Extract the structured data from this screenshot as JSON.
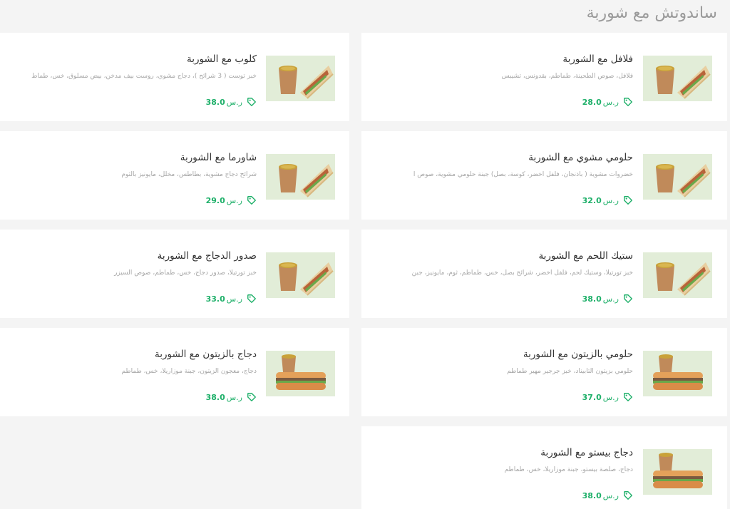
{
  "section": {
    "title": "ساندوتش مع شوربة"
  },
  "currency": "ر.س",
  "colors": {
    "accent": "#1fb06a",
    "thumb_bg": "#e2edd8"
  },
  "items": [
    {
      "name": "فلافل مع الشوربة",
      "description": "فلافل، صوص الطحينة، طماطم، بقدونس، تشيبس",
      "price": "28.0"
    },
    {
      "name": "كلوب مع الشوربة",
      "description": "خبز توست ( 3 شرائح )، دجاج مشوي، روست بيف مدخن، بيض مسلوق، خس، طماط",
      "price": "38.0"
    },
    {
      "name": "حلومي مشوي مع الشوربة",
      "description": "خضروات مشوية ( باذنجان، فلفل اخضر، كوسة، بصل) جبنة حلومي مشوية، صوص ا",
      "price": "32.0"
    },
    {
      "name": "شاورما مع الشوربة",
      "description": "شرائح دجاج مشوية، بطاطس، مخلل، مايونيز بالثوم",
      "price": "29.0"
    },
    {
      "name": "ستيك اللحم مع الشوربة",
      "description": "خبز تورتيلا، وستيك لحم، فلفل اخضر، شرائح بصل، خس، طماطم، ثوم، مايونيز، جبن",
      "price": "38.0"
    },
    {
      "name": "صدور الدجاج مع الشوربة",
      "description": "خبز تورتيلا، صدور دجاج، خس، طماطم، صوص السيزر",
      "price": "33.0"
    },
    {
      "name": "حلومي بالزيتون مع الشوربة",
      "description": "حلومي بزيتون التابيناد، خبز جرجير مهير طماطم",
      "price": "37.0"
    },
    {
      "name": "دجاج بالزيتون مع الشوربة",
      "description": "دجاج، معجون الزيتون، جبنة موزاريلا، خس، طماطم",
      "price": "38.0"
    },
    {
      "name": "دجاج بيستو مع الشوربة",
      "description": "دجاج، صلصة بيستو، جبنة موزاريلا، خس، طماطم",
      "price": "38.0"
    }
  ]
}
